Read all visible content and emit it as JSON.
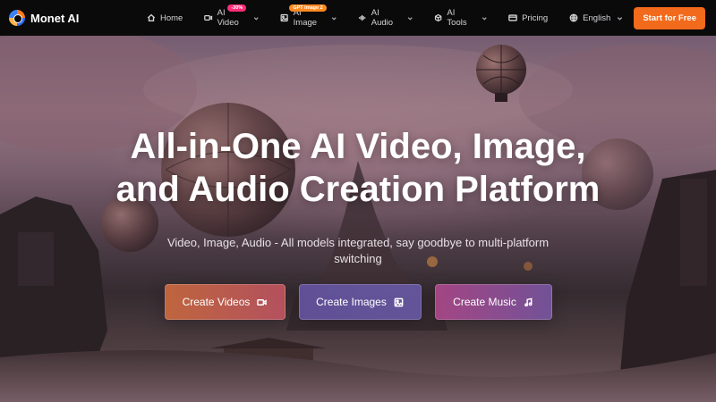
{
  "brand": {
    "name": "Monet AI",
    "logo_icon": "monet-logo-icon"
  },
  "nav": {
    "items": [
      {
        "label": "Home",
        "icon": "home-icon"
      },
      {
        "label": "AI Video",
        "icon": "video-camera-icon",
        "badge": "-30%",
        "dropdown": true
      },
      {
        "label": "AI Image",
        "icon": "image-icon",
        "badge": "GPT Image 2",
        "dropdown": true
      },
      {
        "label": "AI Audio",
        "icon": "audio-wave-icon",
        "dropdown": true
      },
      {
        "label": "AI Tools",
        "icon": "cube-icon",
        "dropdown": true
      },
      {
        "label": "Pricing",
        "icon": "credit-card-icon"
      },
      {
        "label": "English",
        "icon": "globe-icon",
        "dropdown": true
      }
    ],
    "start_label": "Start for Free"
  },
  "hero": {
    "title_line1": "All-in-One AI Video, Image,",
    "title_line2": "and Audio Creation Platform",
    "subtitle": "Video, Image, Audio - All models integrated, say goodbye to multi-platform switching",
    "buttons": [
      {
        "label": "Create Videos",
        "icon": "video-camera-icon"
      },
      {
        "label": "Create Images",
        "icon": "image-icon"
      },
      {
        "label": "Create Music",
        "icon": "music-note-icon"
      }
    ]
  },
  "colors": {
    "accent": "#f26a1b",
    "header_bg": "#0a0a0a",
    "badge_video": "#ff2d78",
    "badge_image": "#ff8a1f"
  }
}
